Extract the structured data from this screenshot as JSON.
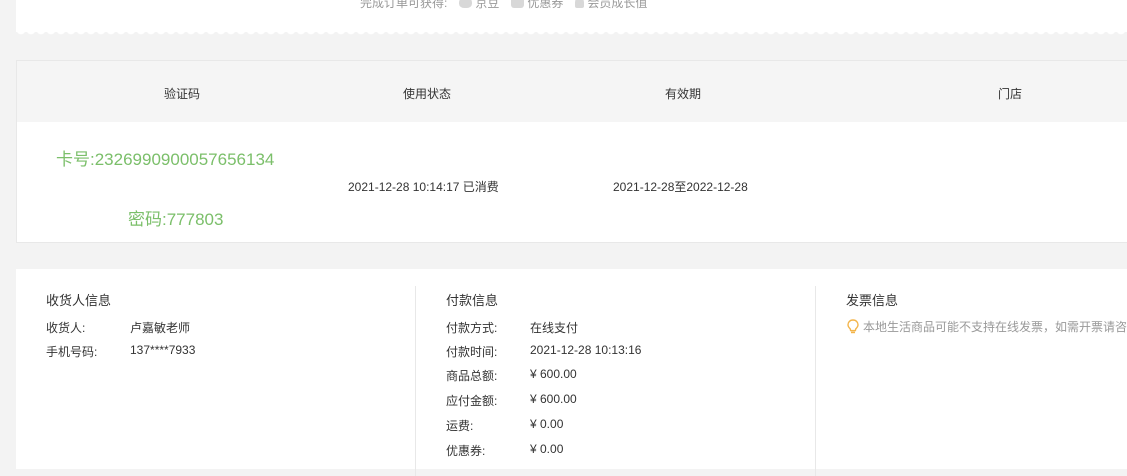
{
  "rewards": {
    "label": "完成订单可获得:",
    "items": [
      {
        "icon": "bean-icon",
        "label": "京豆"
      },
      {
        "icon": "coupon-icon",
        "label": "优惠券"
      },
      {
        "icon": "member-icon",
        "label": "会员成长值"
      }
    ]
  },
  "card_table": {
    "headers": {
      "code": "验证码",
      "status": "使用状态",
      "validity": "有效期",
      "store": "门店"
    },
    "card_number": "卡号:2326990900057656134",
    "password": "密码:777803",
    "used_time": "2021-12-28 10:14:17 已消费",
    "valid_range": "2021-12-28至2022-12-28",
    "accent_color": "#7bbf6a"
  },
  "receiver": {
    "title": "收货人信息",
    "rows": [
      {
        "label": "收货人:",
        "value": "卢嘉敏老师"
      },
      {
        "label": "手机号码:",
        "value": "137****7933"
      }
    ]
  },
  "payment": {
    "title": "付款信息",
    "rows": [
      {
        "label": "付款方式:",
        "value": "在线支付"
      },
      {
        "label": "付款时间:",
        "value": "2021-12-28 10:13:16"
      },
      {
        "label": "商品总额:",
        "value": "¥ 600.00"
      },
      {
        "label": "应付金额:",
        "value": "¥ 600.00"
      },
      {
        "label": "运费:",
        "value": "¥ 0.00"
      },
      {
        "label": "优惠券:",
        "value": "¥ 0.00"
      }
    ]
  },
  "invoice": {
    "title": "发票信息",
    "note": "本地生活商品可能不支持在线发票，如需开票请咨"
  }
}
